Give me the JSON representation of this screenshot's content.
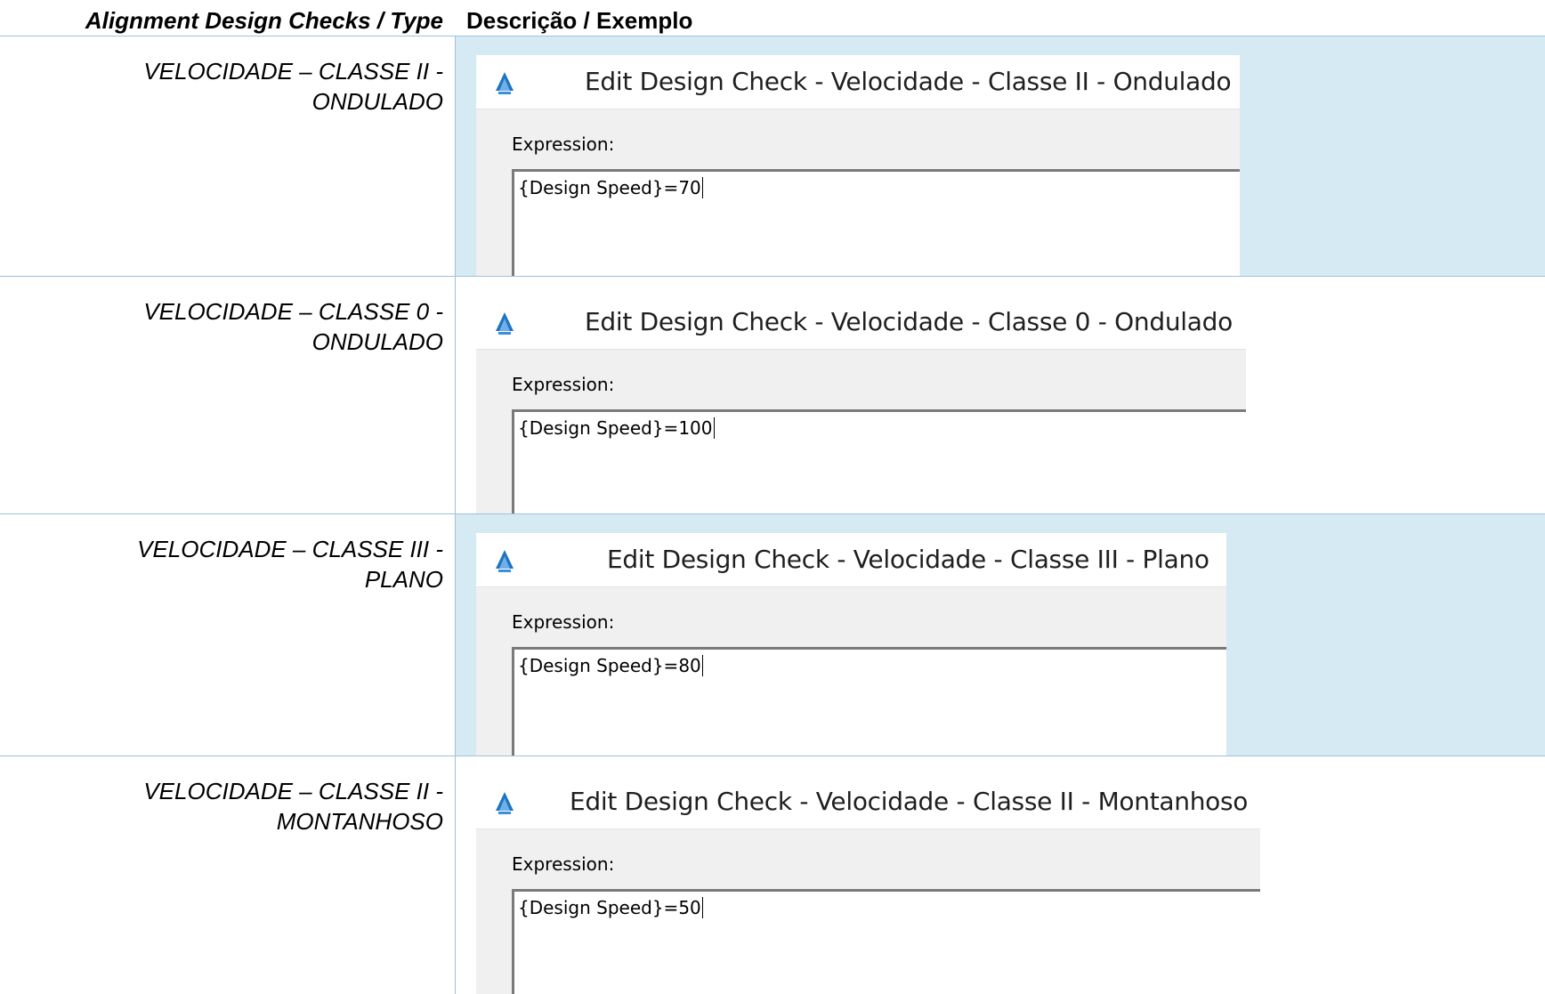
{
  "table": {
    "header": {
      "type_column": "Alignment Design Checks / Type",
      "description_column": "Descrição / Exemplo"
    },
    "rows": [
      {
        "type_line1": "VELOCIDADE – CLASSE II -",
        "type_line2": "ONDULADO",
        "dialog_title": "Edit Design Check - Velocidade - Classe II - Ondulado",
        "expression_label": "Expression:",
        "expression_value": "{Design Speed}=70"
      },
      {
        "type_line1": "VELOCIDADE – CLASSE 0 -",
        "type_line2": "ONDULADO",
        "dialog_title": "Edit Design Check - Velocidade - Classe 0 - Ondulado",
        "expression_label": "Expression:",
        "expression_value": "{Design Speed}=100"
      },
      {
        "type_line1": "VELOCIDADE – CLASSE III -",
        "type_line2": "PLANO",
        "dialog_title": "Edit Design Check - Velocidade - Classe III - Plano",
        "expression_label": "Expression:",
        "expression_value": "{Design Speed}=80"
      },
      {
        "type_line1": "VELOCIDADE – CLASSE II -",
        "type_line2": "MONTANHOSO",
        "dialog_title": "Edit Design Check - Velocidade - Classe II - Montanhoso",
        "expression_label": "Expression:",
        "expression_value": "{Design Speed}=50"
      }
    ]
  },
  "icons": {
    "dialog_icon": "autocad-civil-app-icon"
  },
  "colors": {
    "shaded_row": "#d6eaf4",
    "rule_line": "#9cc3dc",
    "icon_blue": "#1f74c2"
  }
}
